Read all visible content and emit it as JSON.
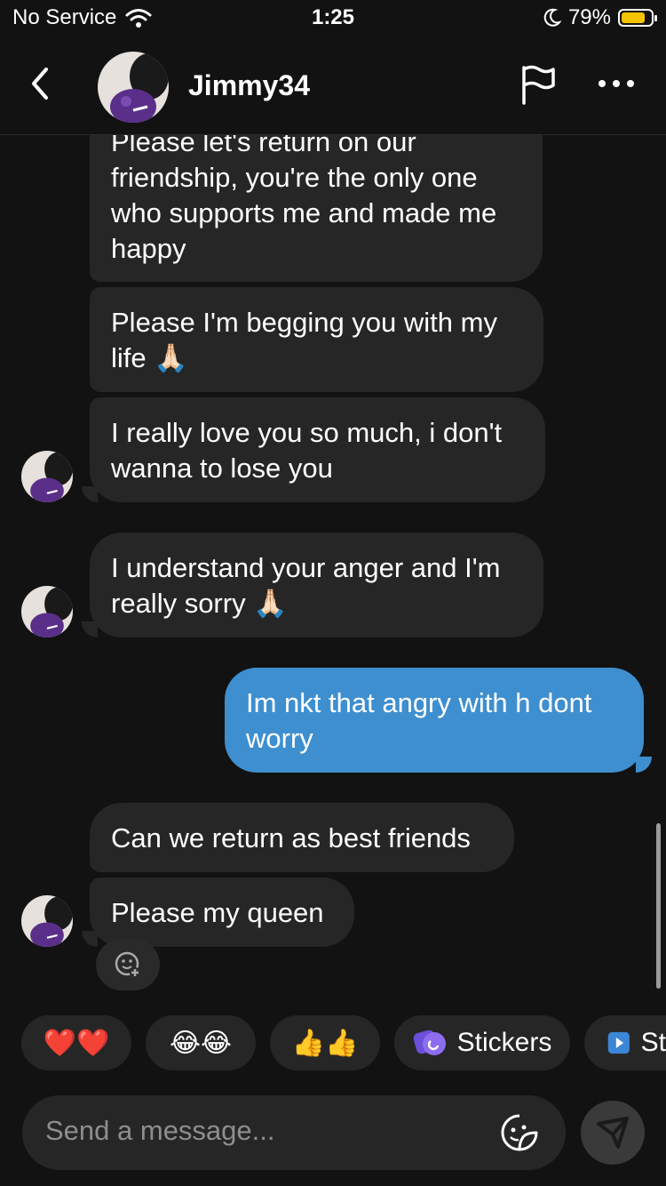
{
  "status": {
    "carrier": "No Service",
    "time": "1:25",
    "battery": "79%"
  },
  "header": {
    "username": "Jimmy34"
  },
  "messages": [
    {
      "text_lines": [
        "Please let's return on our",
        "friendship, you're the only one",
        "who supports me and made me",
        "happy"
      ]
    },
    {
      "text": "Please I'm begging you with my life 🙏🏻"
    },
    {
      "text": "I really love you so much, i don't wanna to lose you"
    },
    {
      "text": "I understand your anger and I'm really sorry 🙏🏻"
    },
    {
      "text": "Im nkt that angry with h dont worry"
    },
    {
      "text": "Can we return as best friends"
    },
    {
      "text": "Please my queen"
    }
  ],
  "quick_reactions": [
    {
      "label": "❤️❤️"
    },
    {
      "label": "😂😂"
    },
    {
      "label": "👍👍"
    },
    {
      "label": "Stickers"
    },
    {
      "label": "St"
    }
  ],
  "composer": {
    "placeholder": "Send a message..."
  },
  "colors": {
    "background": "#121212",
    "incoming_bubble": "#262626",
    "outgoing_bubble": "#3e8fcf"
  }
}
